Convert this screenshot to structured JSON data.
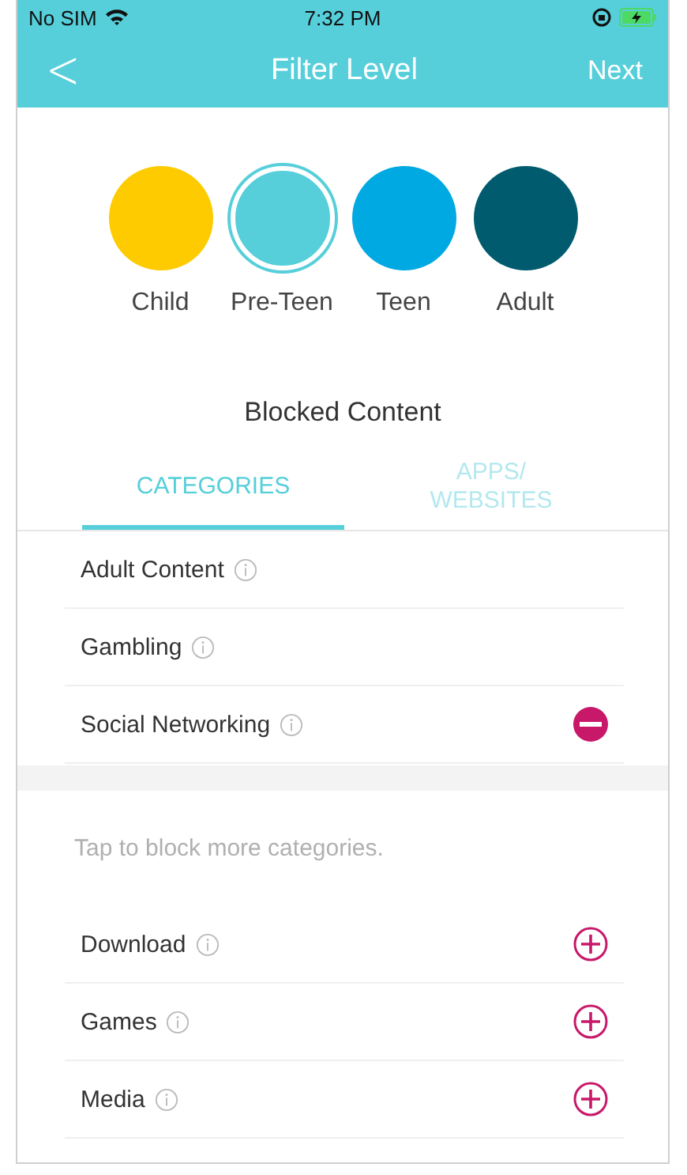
{
  "status_bar": {
    "carrier": "No SIM",
    "time": "7:32 PM"
  },
  "nav": {
    "back": "<",
    "title": "Filter Level",
    "action": "Next"
  },
  "levels": [
    {
      "label": "Child",
      "color": "#fdcb00",
      "selected": false
    },
    {
      "label": "Pre-Teen",
      "color": "#56cfda",
      "selected": true
    },
    {
      "label": "Teen",
      "color": "#00a9e2",
      "selected": false
    },
    {
      "label": "Adult",
      "color": "#005b6e",
      "selected": false
    }
  ],
  "section_title": "Blocked Content",
  "tabs": [
    {
      "label": "CATEGORIES",
      "selected": true
    },
    {
      "label": "APPS/\nWEBSITES",
      "selected": false
    }
  ],
  "blocked": [
    {
      "name": "Adult Content",
      "kind": "fixed"
    },
    {
      "name": "Gambling",
      "kind": "fixed"
    },
    {
      "name": "Social Networking",
      "kind": "remove"
    }
  ],
  "hint": "Tap to block more categories.",
  "available": [
    {
      "name": "Download",
      "kind": "add"
    },
    {
      "name": "Games",
      "kind": "add"
    },
    {
      "name": "Media",
      "kind": "add"
    }
  ]
}
